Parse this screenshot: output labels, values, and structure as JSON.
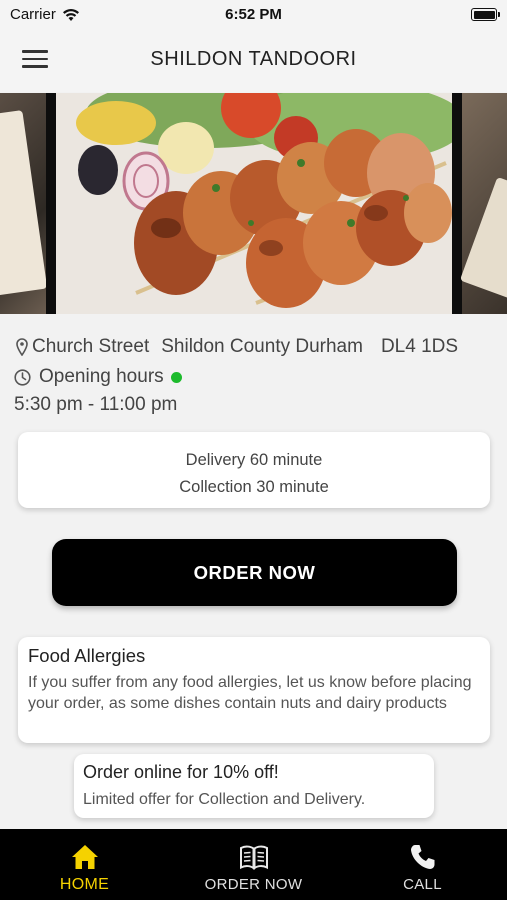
{
  "status_bar": {
    "carrier": "Carrier",
    "time": "6:52 PM"
  },
  "nav": {
    "title": "SHILDON TANDOORI"
  },
  "restaurant": {
    "address_street": "Church Street",
    "address_area": "Shildon County Durham",
    "address_postcode": "DL4 1DS",
    "opening_label": "Opening hours",
    "opening_status_color": "#1dbb2c",
    "hours": "5:30 pm - 11:00 pm"
  },
  "service_times": {
    "delivery": "Delivery 60 minute",
    "collection": "Collection 30 minute"
  },
  "order_button": {
    "label": "ORDER NOW"
  },
  "allergy_notice": {
    "title": "Food Allergies",
    "text": "If you suffer from any food allergies, let us know before placing your order, as some dishes contain nuts and dairy products"
  },
  "promo": {
    "title": "Order online for 10% off!",
    "text": "Limited offer for Collection and Delivery."
  },
  "tab_bar": {
    "items": [
      {
        "label": "HOME",
        "icon": "home-icon",
        "active": true
      },
      {
        "label": "ORDER NOW",
        "icon": "menu-book-icon",
        "active": false
      },
      {
        "label": "CALL",
        "icon": "phone-icon",
        "active": false
      }
    ]
  },
  "colors": {
    "accent": "#f5d200",
    "tab_bar_bg": "#000000",
    "button_bg": "#000000"
  }
}
